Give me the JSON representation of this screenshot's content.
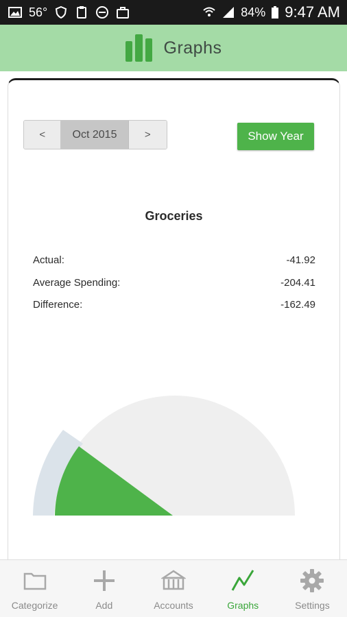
{
  "status_bar": {
    "temperature": "56°",
    "battery": "84%",
    "time": "9:47 AM"
  },
  "header": {
    "title": "Graphs",
    "logo_icon": "bar-chart-logo-icon"
  },
  "period_nav": {
    "prev_label": "<",
    "month": "Oct 2015",
    "next_label": ">"
  },
  "show_year_label": "Show Year",
  "category": {
    "title": "Groceries",
    "rows": [
      {
        "label": "Actual:",
        "value": "-41.92"
      },
      {
        "label": "Average Spending:",
        "value": "-204.41"
      },
      {
        "label": "Difference:",
        "value": "-162.49"
      }
    ]
  },
  "gauge": {
    "actual_spent": 41.92,
    "average_spending": 204.41,
    "colors": {
      "actual": "#4eb34a",
      "average": "#dbe3ea",
      "track": "#efefef"
    }
  },
  "tabs": [
    {
      "label": "Categorize",
      "icon": "folder-icon",
      "active": false
    },
    {
      "label": "Add",
      "icon": "plus-icon",
      "active": false
    },
    {
      "label": "Accounts",
      "icon": "bank-icon",
      "active": false
    },
    {
      "label": "Graphs",
      "icon": "graph-line-icon",
      "active": true
    },
    {
      "label": "Settings",
      "icon": "gear-icon",
      "active": false
    }
  ],
  "colors": {
    "accent": "#4eb34a",
    "header_bg": "#a4dba6"
  }
}
